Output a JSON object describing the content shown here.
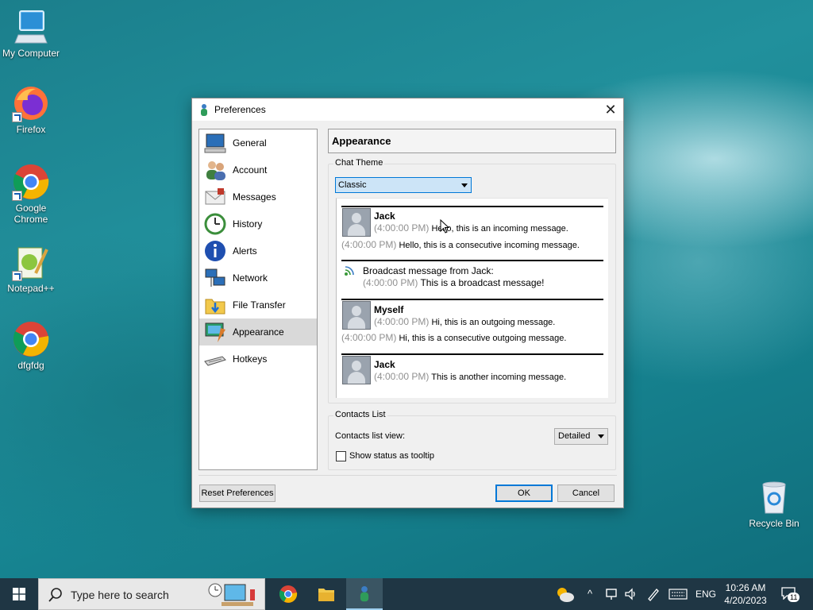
{
  "desktop": {
    "icons": [
      {
        "label": "My Computer"
      },
      {
        "label": "Firefox"
      },
      {
        "label": "Google Chrome"
      },
      {
        "label": "Notepad++"
      },
      {
        "label": "dfgfdg"
      },
      {
        "label": "Recycle Bin"
      }
    ]
  },
  "dialog": {
    "title": "Preferences",
    "close_glyph": "✕",
    "nav": [
      {
        "label": "General",
        "icon": "monitor-icon"
      },
      {
        "label": "Account",
        "icon": "users-icon"
      },
      {
        "label": "Messages",
        "icon": "envelope-icon"
      },
      {
        "label": "History",
        "icon": "clock-icon"
      },
      {
        "label": "Alerts",
        "icon": "info-icon"
      },
      {
        "label": "Network",
        "icon": "network-icon"
      },
      {
        "label": "File Transfer",
        "icon": "folder-icon"
      },
      {
        "label": "Appearance",
        "icon": "appearance-icon",
        "selected": true
      },
      {
        "label": "Hotkeys",
        "icon": "keyboard-icon"
      }
    ],
    "header": "Appearance",
    "chat_theme": {
      "group_label": "Chat Theme",
      "selected": "Classic"
    },
    "preview": {
      "blocks": [
        {
          "sender": "Jack",
          "time": "(4:00:00 PM)",
          "text": "Hello, this is an incoming message.",
          "consecutive_time": "(4:00:00 PM)",
          "consecutive_text": "Hello, this is a consecutive incoming message."
        },
        {
          "broadcast_title": "Broadcast message from Jack:",
          "time": "(4:00:00 PM)",
          "text": "This is a broadcast message!"
        },
        {
          "sender": "Myself",
          "time": "(4:00:00 PM)",
          "text": "Hi, this is an outgoing message.",
          "consecutive_time": "(4:00:00 PM)",
          "consecutive_text": "Hi, this is a consecutive outgoing message."
        },
        {
          "sender": "Jack",
          "time": "(4:00:00 PM)",
          "text": "This is another incoming message."
        }
      ]
    },
    "contacts": {
      "group_label": "Contacts List",
      "view_label": "Contacts list view:",
      "view_value": "Detailed",
      "tooltip_checkbox": "Show status as tooltip",
      "tooltip_checked": false
    },
    "buttons": {
      "reset": "Reset Preferences",
      "ok": "OK",
      "cancel": "Cancel"
    }
  },
  "taskbar": {
    "search_placeholder": "Type here to search",
    "language": "ENG",
    "time": "10:26 AM",
    "date": "4/20/2023",
    "notification_count": "11"
  }
}
